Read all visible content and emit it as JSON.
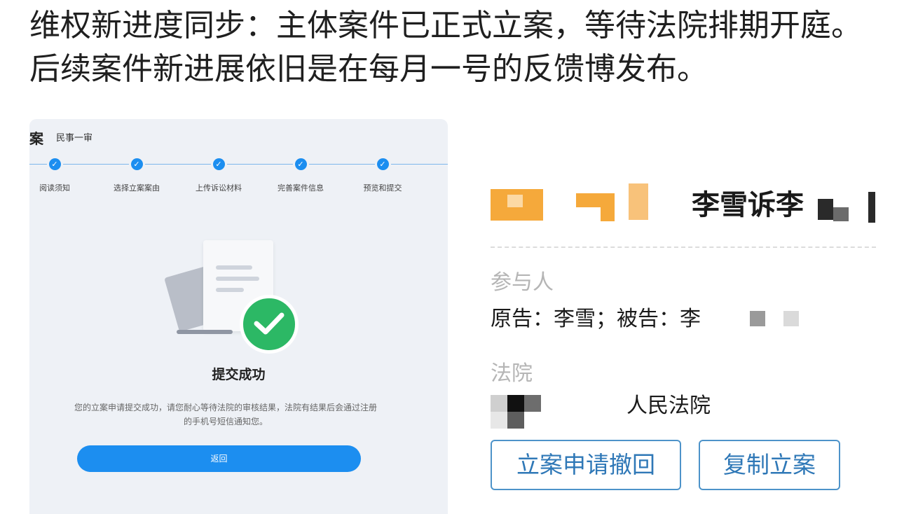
{
  "post": {
    "text": "维权新进度同步：主体案件已正式立案，等待法院排期开庭。后续案件新进展依旧是在每月一号的反馈博发布。"
  },
  "left_screenshot": {
    "case_title": "案",
    "case_type": "民事一审",
    "steps": [
      {
        "label": "阅读须知"
      },
      {
        "label": "选择立案案由"
      },
      {
        "label": "上传诉讼材料"
      },
      {
        "label": "完善案件信息"
      },
      {
        "label": "预览和提交"
      }
    ],
    "success_title": "提交成功",
    "success_desc": "您的立案申请提交成功，请您耐心等待法院的审核结果，法院有结果后会通过注册的手机号短信通知您。",
    "return_label": "返回",
    "colors": {
      "accent": "#1c8ef0",
      "success": "#2cb865"
    }
  },
  "right_screenshot": {
    "case_name": "李雪诉李",
    "participants_label": "参与人",
    "participants_value": "原告：李雪；被告：李",
    "court_label": "法院",
    "court_value": "人民法院",
    "withdraw_button": "立案申请撤回",
    "copy_button": "复制立案",
    "colors": {
      "button_border": "#4d93c9",
      "button_text": "#2f78b7"
    }
  }
}
